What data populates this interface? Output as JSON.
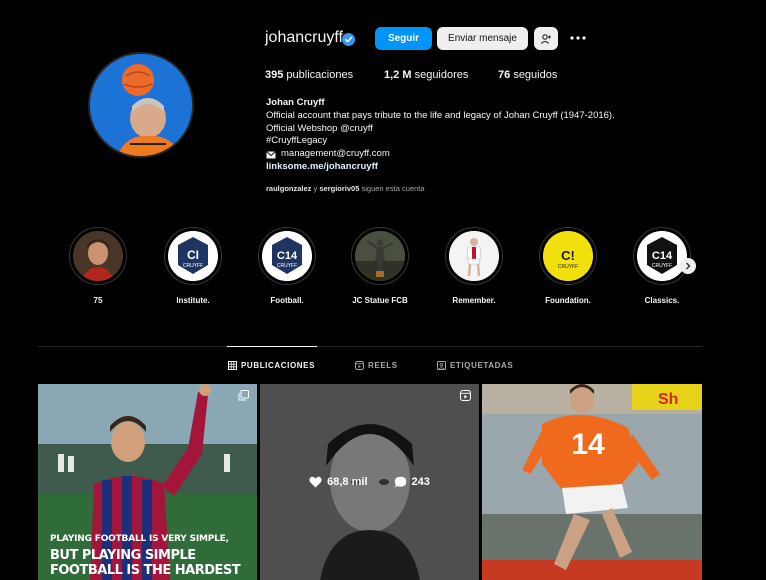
{
  "profile": {
    "username": "johancruyff",
    "follow_label": "Seguir",
    "message_label": "Enviar mensaje",
    "stats": {
      "posts_count": "395",
      "posts_label": "publicaciones",
      "followers_count": "1,2 M",
      "followers_label": "seguidores",
      "following_count": "76",
      "following_label": "seguidos"
    },
    "bio": {
      "name": "Johan Cruyff",
      "line1": "Official account that pays tribute to the life and legacy of Johan Cruyff (1947-2016).",
      "line2": "Official Webshop @cruyff",
      "line3": "#CruyffLegacy",
      "email": "management@cruyff.com",
      "link": "linksome.me/johancruyff"
    },
    "followed_by": {
      "user1": "raulgonzalez",
      "conj": "y",
      "user2": "sergioriv05",
      "suffix": "siguen esta cuenta"
    }
  },
  "highlights": [
    {
      "label": "75"
    },
    {
      "label": "Institute."
    },
    {
      "label": "Football."
    },
    {
      "label": "JC Statue FCB"
    },
    {
      "label": "Remember."
    },
    {
      "label": "Foundation."
    },
    {
      "label": "Classics."
    }
  ],
  "highlight_logos": {
    "institute": {
      "top": "CI",
      "sub": "CRUYFF"
    },
    "football": {
      "top": "C14",
      "sub": "CRUYFF"
    },
    "foundation": {
      "top": "C!",
      "sub": "CRUYFF"
    },
    "classics": {
      "top": "C14",
      "sub": "CRUYFF"
    }
  },
  "tabs": [
    {
      "label": "PUBLICACIONES",
      "active": true
    },
    {
      "label": "REELS",
      "active": false
    },
    {
      "label": "ETIQUETADAS",
      "active": false
    }
  ],
  "posts": [
    {
      "overlay_line1": "PLAYING FOOTBALL IS VERY SIMPLE,",
      "overlay_line2": "BUT PLAYING SIMPLE",
      "overlay_line3": "FOOTBALL IS THE HARDEST",
      "type_icon": "carousel-icon"
    },
    {
      "likes": "68,8 mil",
      "comments": "243",
      "type_icon": "reel-icon"
    },
    {
      "jersey_number": "14",
      "banner_text": "Sh"
    }
  ],
  "colors": {
    "background": "#000000",
    "accent": "#0095f6",
    "secondary_button": "#efefef",
    "muted_text": "#a8a8a8",
    "divider": "#262626",
    "verified_badge": "#3897f0"
  }
}
